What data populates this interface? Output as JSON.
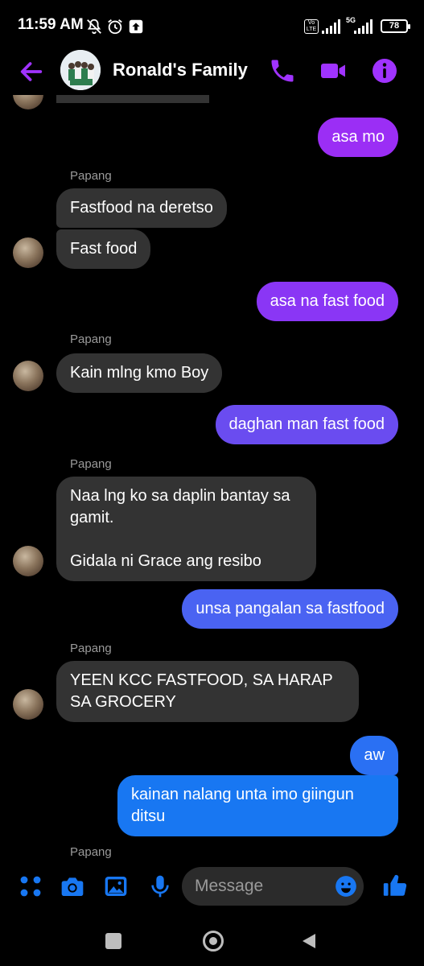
{
  "status_bar": {
    "time": "11:59 AM",
    "battery": "78",
    "network": "5G",
    "volte": "Vo LTE",
    "icons": [
      "mute-icon",
      "alarm-icon",
      "upload-notification-icon",
      "signal-icon",
      "battery-icon"
    ]
  },
  "header": {
    "title": "Ronald's Family",
    "icons": [
      "back-arrow-icon",
      "phone-icon",
      "video-call-icon",
      "info-icon"
    ]
  },
  "messages": [
    {
      "direction": "in",
      "text": ""
    },
    {
      "direction": "out",
      "text": "asa mo"
    },
    {
      "direction": "in",
      "sender": "Papang",
      "text": "Fastfood na deretso"
    },
    {
      "direction": "in",
      "text": "Fast food"
    },
    {
      "direction": "out",
      "text": "asa na fast food"
    },
    {
      "direction": "in",
      "sender": "Papang",
      "text": "Kain mlng kmo Boy"
    },
    {
      "direction": "out",
      "text": "daghan man fast food"
    },
    {
      "direction": "in",
      "sender": "Papang",
      "text": "Naa lng ko sa daplin bantay sa\ngamit.\n\nGidala ni Grace ang resibo"
    },
    {
      "direction": "out",
      "text": "unsa pangalan sa fastfood"
    },
    {
      "direction": "in",
      "sender": "Papang",
      "text": "YEEN KCC FASTFOOD, SA HARAP\nSA GROCERY"
    },
    {
      "direction": "out",
      "text": "aw"
    },
    {
      "direction": "out",
      "text": "kainan nalang unta imo giingun\nditsu"
    },
    {
      "direction": "in",
      "sender": "Papang",
      "text": ""
    }
  ],
  "senders": {
    "papang": "Papang"
  },
  "composer": {
    "placeholder": "Message",
    "icons": [
      "apps-icon",
      "camera-icon",
      "gallery-icon",
      "microphone-icon",
      "emoji-icon",
      "thumbs-up-icon"
    ]
  },
  "nav_bar": {
    "icons": [
      "recents-square-icon",
      "home-circle-icon",
      "back-triangle-icon"
    ]
  },
  "colors": {
    "accent": "#a033ff",
    "bubble_out_top": "#9b2ef5",
    "bubble_out_mid": "#6a4cf0",
    "bubble_out_bottom": "#1877f2",
    "bubble_in": "#333333",
    "background": "#000000"
  }
}
